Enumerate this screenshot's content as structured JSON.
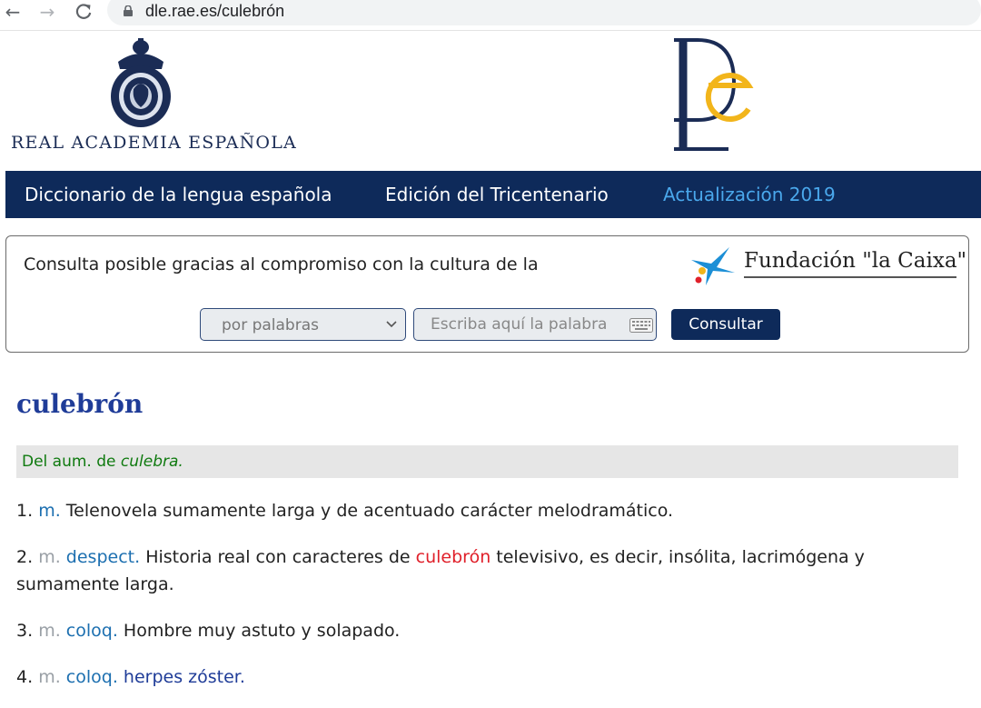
{
  "browser": {
    "url": "dle.rae.es/culebrón",
    "back_icon": "arrow-left-icon",
    "forward_icon": "arrow-right-icon",
    "reload_icon": "reload-icon",
    "lock_icon": "lock-icon"
  },
  "header": {
    "rae_name": "REAL ACADEMIA ESPAÑOLA",
    "crest_icon": "rae-crest-icon",
    "dle_logo": "dle-logo-icon"
  },
  "nav": {
    "items": [
      {
        "label": "Diccionario de la lengua española"
      },
      {
        "label": "Edición del Tricentenario"
      },
      {
        "label": "Actualización 2019"
      }
    ]
  },
  "search": {
    "sponsor_text": "Consulta posible gracias al compromiso con la cultura de la",
    "sponsor_name": "Fundación \"la Caixa\"",
    "mode_value": "por palabras",
    "input_placeholder": "Escriba aquí la palabra",
    "submit_label": "Consultar"
  },
  "entry": {
    "headword": "culebrón",
    "etymology_prefix": "Del aum. de",
    "etymology_word": "culebra.",
    "definitions": [
      {
        "num": "1.",
        "abbrs": [
          "m."
        ],
        "text": "Telenovela sumamente larga y de acentuado carácter melodramático."
      },
      {
        "num": "2.",
        "abbrs": [
          "m.",
          "despect."
        ],
        "text_before": "Historia real con caracteres de",
        "keyword": "culebrón",
        "text_after": "televisivo, es decir, insólita, lacrimógena y sumamente larga."
      },
      {
        "num": "3.",
        "abbrs": [
          "m.",
          "coloq."
        ],
        "text": "Hombre muy astuto y solapado."
      },
      {
        "num": "4.",
        "abbrs": [
          "m.",
          "coloq."
        ],
        "link": "herpes zóster."
      }
    ]
  },
  "colors": {
    "navy": "#0e2a5a",
    "active_nav": "#4aa8ec",
    "headword_blue": "#1f3c98",
    "etym_green": "#0f7a0f",
    "keyword_red": "#e0202a",
    "abbr_blue": "#1c6fb0",
    "dle_gold": "#f2b51b"
  }
}
